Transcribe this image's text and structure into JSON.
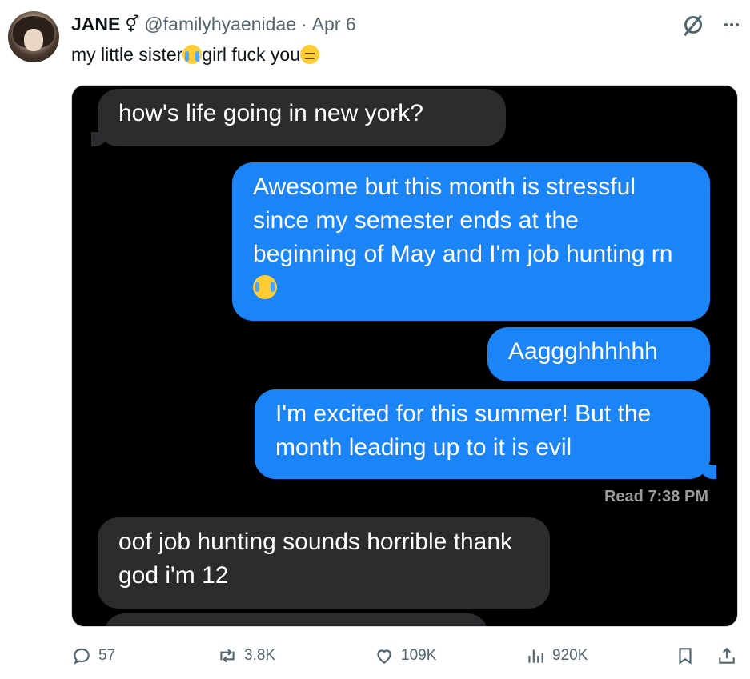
{
  "tweet": {
    "author_name": "JANE",
    "author_badge": "⚥",
    "handle": "@familyhyaenidae",
    "separator": "·",
    "date": "Apr 6",
    "text_part1": "my little sister",
    "emoji1": "loudly-crying-face",
    "text_part2": "girl fuck you",
    "emoji2": "pensive-face"
  },
  "screenshot": {
    "messages": [
      {
        "side": "incoming",
        "text": "how's life going in new york?"
      },
      {
        "side": "outgoing",
        "text": "Awesome but this month is stressful since my semester ends at the beginning of May and I'm job hunting rn",
        "emoji": "loudly-crying-face"
      },
      {
        "side": "outgoing",
        "text": "Aaggghhhhhh"
      },
      {
        "side": "outgoing",
        "text": "I'm excited for this summer! But the month leading up to it is evil"
      },
      {
        "side": "incoming",
        "text": "oof job hunting sounds horrible thank god i'm 12"
      }
    ],
    "read_receipt": "Read 7:38 PM"
  },
  "actions": {
    "replies": "57",
    "reposts": "3.8K",
    "likes": "109K",
    "views": "920K"
  },
  "colors": {
    "outgoing_bubble": "#1b84f6",
    "incoming_bubble": "#2c2c2e",
    "muted_text": "#536471"
  },
  "icons": {
    "top_right": [
      "grok-slash-icon",
      "more-icon"
    ],
    "actions": [
      "reply-icon",
      "repost-icon",
      "like-icon",
      "views-icon",
      "bookmark-icon",
      "share-icon"
    ]
  }
}
